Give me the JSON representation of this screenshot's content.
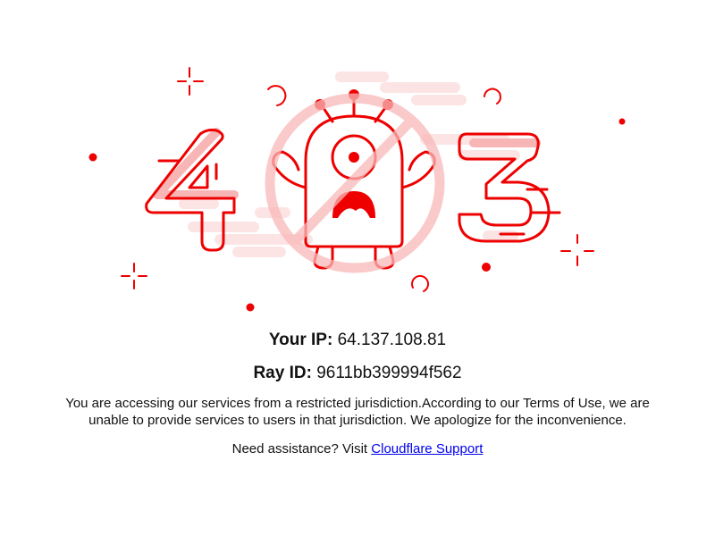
{
  "illustration": {
    "digit_left": "4",
    "digit_right": "3",
    "accent_color": "#ee0000",
    "faded_color": "#fcdede",
    "icons": [
      "blocked-robot-icon",
      "prohibited-sign-icon",
      "sparkle-icon"
    ]
  },
  "ip": {
    "label": "Your IP:",
    "value": "64.137.108.81"
  },
  "ray": {
    "label": "Ray ID:",
    "value": "9611bb399994f562"
  },
  "message": "You are accessing our services from a restricted jurisdiction.According to our Terms of Use, we are unable to provide services to users in that jurisdiction. We apologize for the inconvenience.",
  "help": {
    "prefix": "Need assistance? Visit",
    "link_text": "Cloudflare Support"
  }
}
